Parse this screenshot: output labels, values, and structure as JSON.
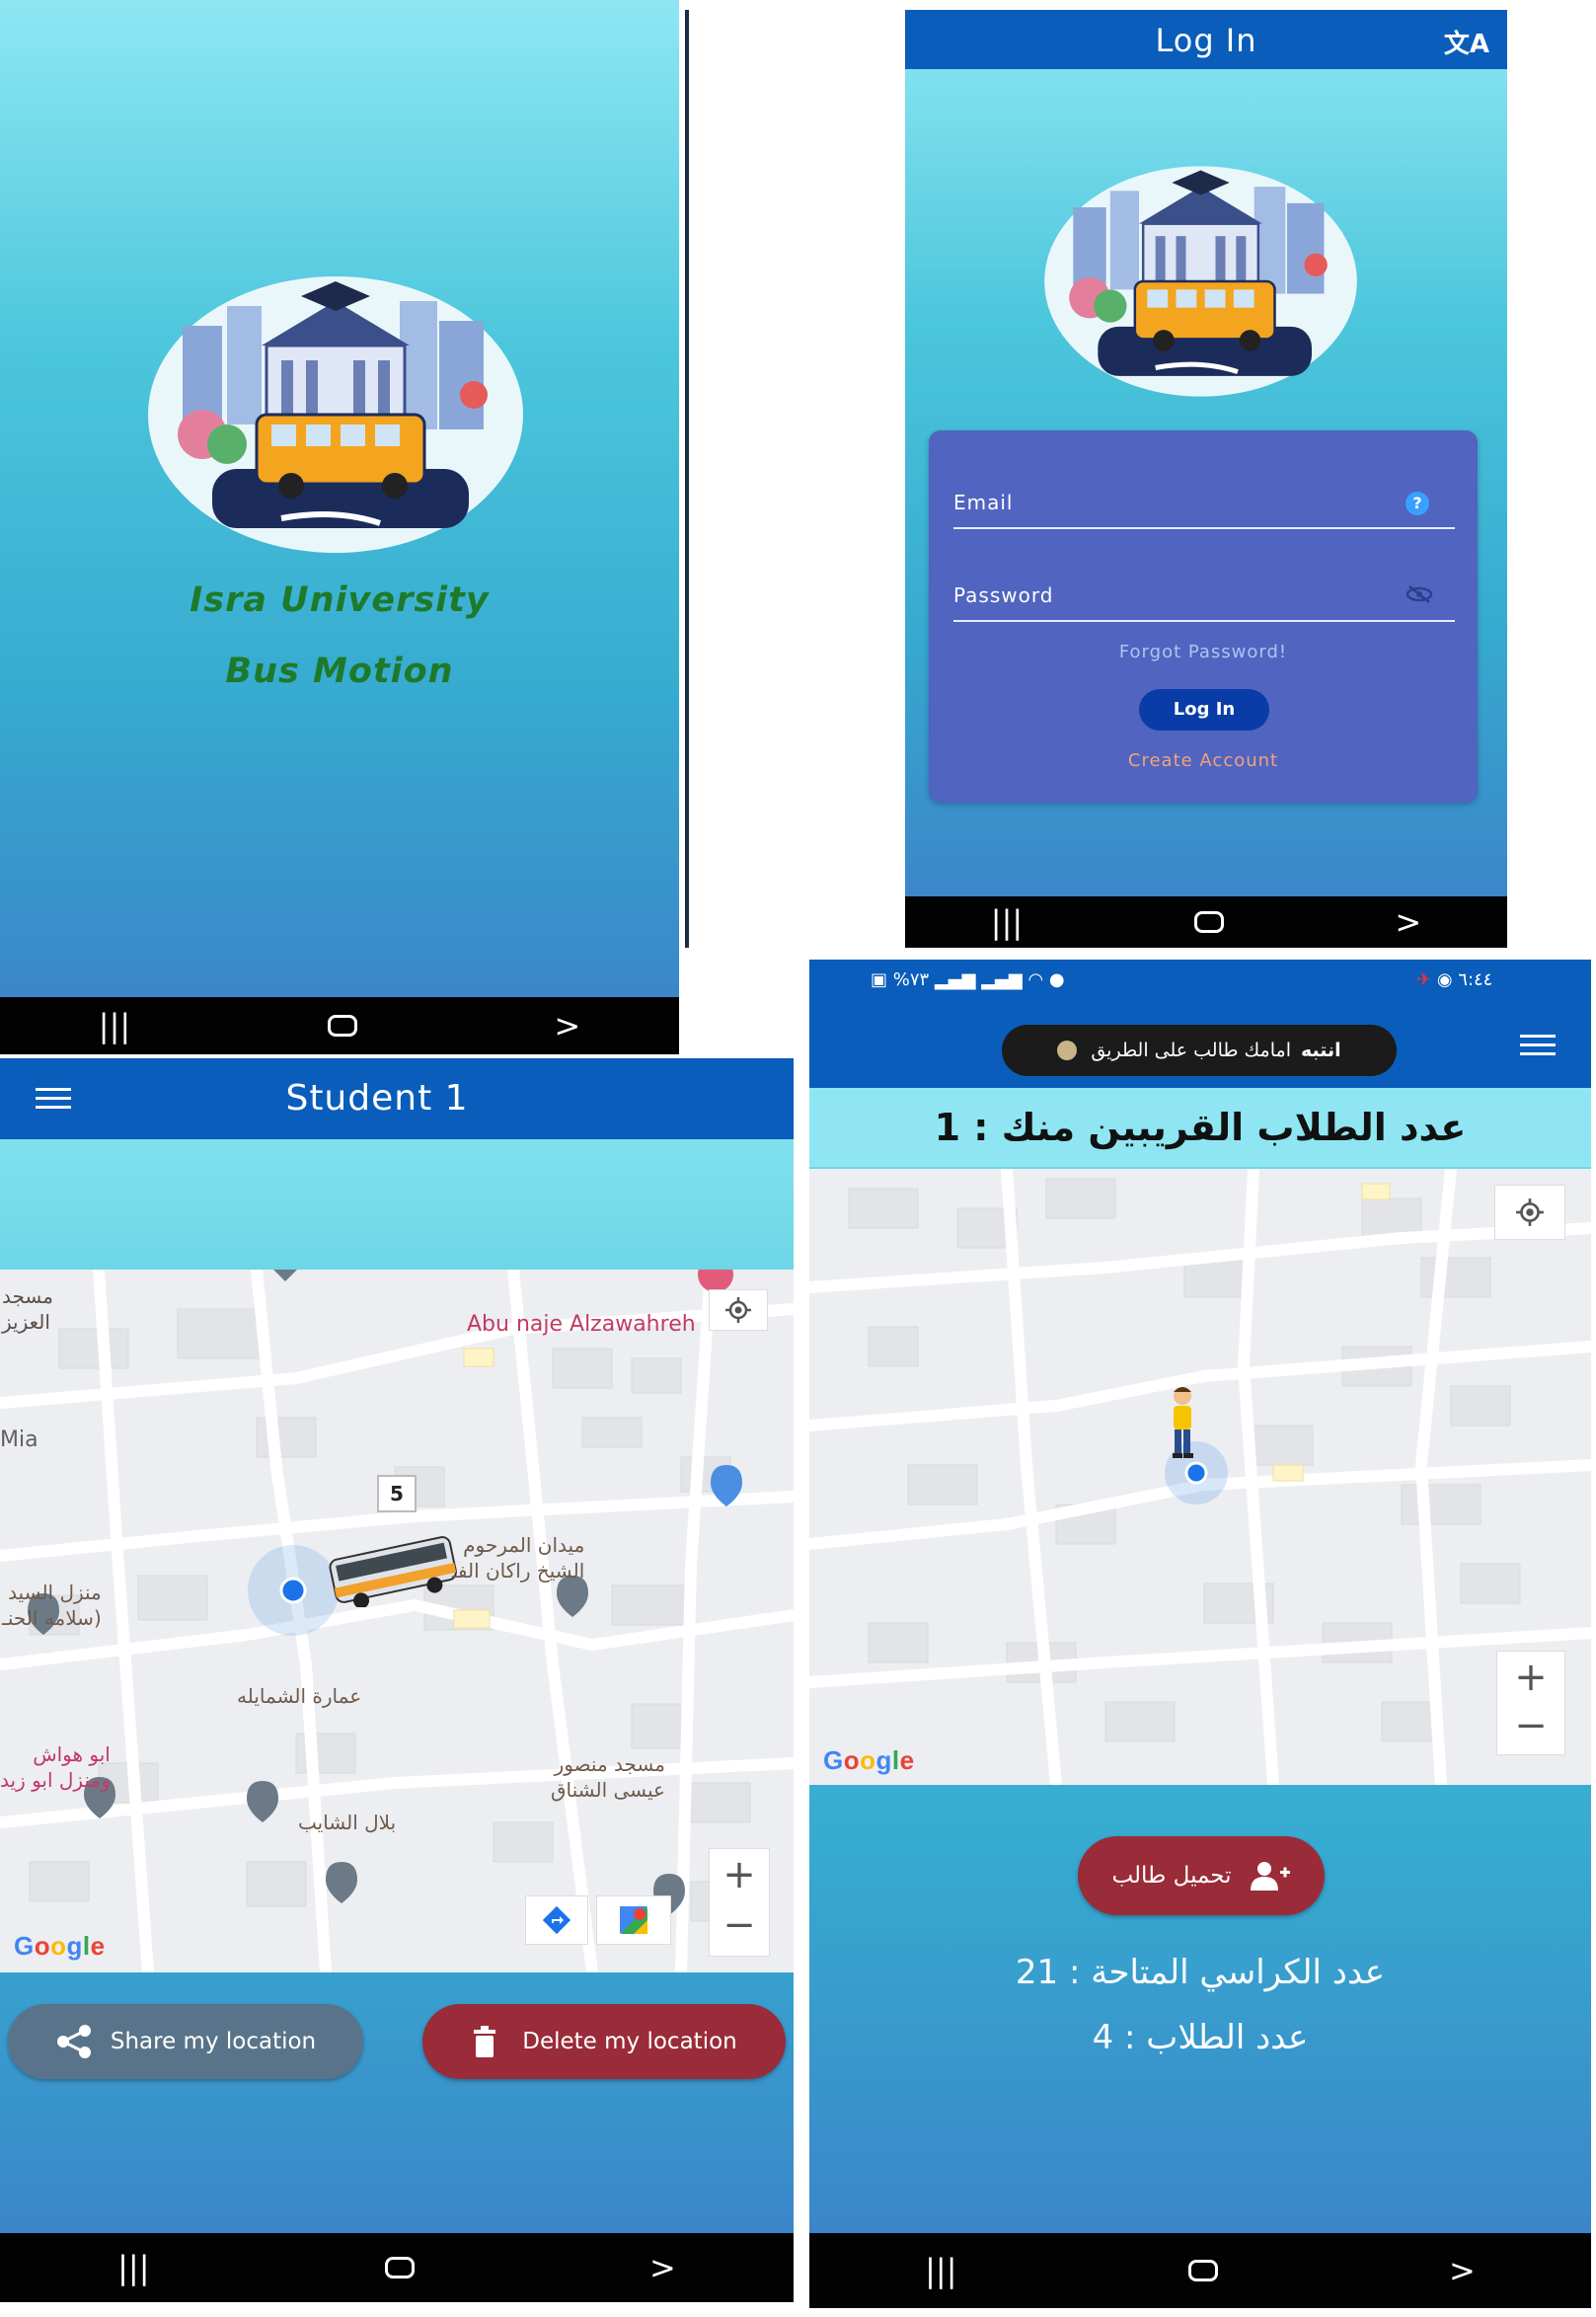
{
  "splash": {
    "title_line1": "Isra University",
    "title_line2": "Bus Motion"
  },
  "login": {
    "header_title": "Log In",
    "email_label": "Email",
    "password_label": "Password",
    "forgot_password": "Forgot Password!",
    "login_button": "Log In",
    "create_account": "Create Account",
    "translate_icon": "translate-icon"
  },
  "student": {
    "header_title": "Student 1",
    "bus_cluster_count": "5",
    "map_labels": {
      "masjid_aziz": "مسجد\nالعزيز",
      "abu_naje": "Abu naje Alzawahreh",
      "mia": "Mia",
      "maydan": "ميدان المرحوم\nالشيخ راكان الفـ",
      "manzil_sayed": "منزل السيد\nسلامه الحنـ)",
      "imarat": "عمارة الشمايله",
      "abu_hawash": "ابو هواش\nومنزل ابو زيد",
      "masjid_mansour": "مسجد منصور\nعيسى الشناق",
      "bilal": "بلال الشايب"
    },
    "share_button": "Share my location",
    "delete_button": "Delete my location",
    "google": "Google"
  },
  "driver": {
    "status_left": "%٧٣",
    "status_right": "٦:٤٤",
    "toast": "انتبه امامك طالب على الطريق",
    "toast_bold": "انتبه",
    "toast_rest": "امامك طالب على الطريق",
    "nearby_label": "عدد الطلاب القريبين منك : 1",
    "load_button": "تحميل طالب",
    "seats_label": "عدد الكراسي المتاحة : 21",
    "students_label": "عدد الطلاب : 4",
    "google": "Google"
  },
  "colors": {
    "header_blue": "#0a5dbb",
    "form_card": "#5064c0",
    "login_button": "#0a3ca8",
    "share_button": "#59748a",
    "delete_button": "#9a2b38",
    "splash_text": "#1e7a2a",
    "accent_orange": "#f2a27a"
  }
}
